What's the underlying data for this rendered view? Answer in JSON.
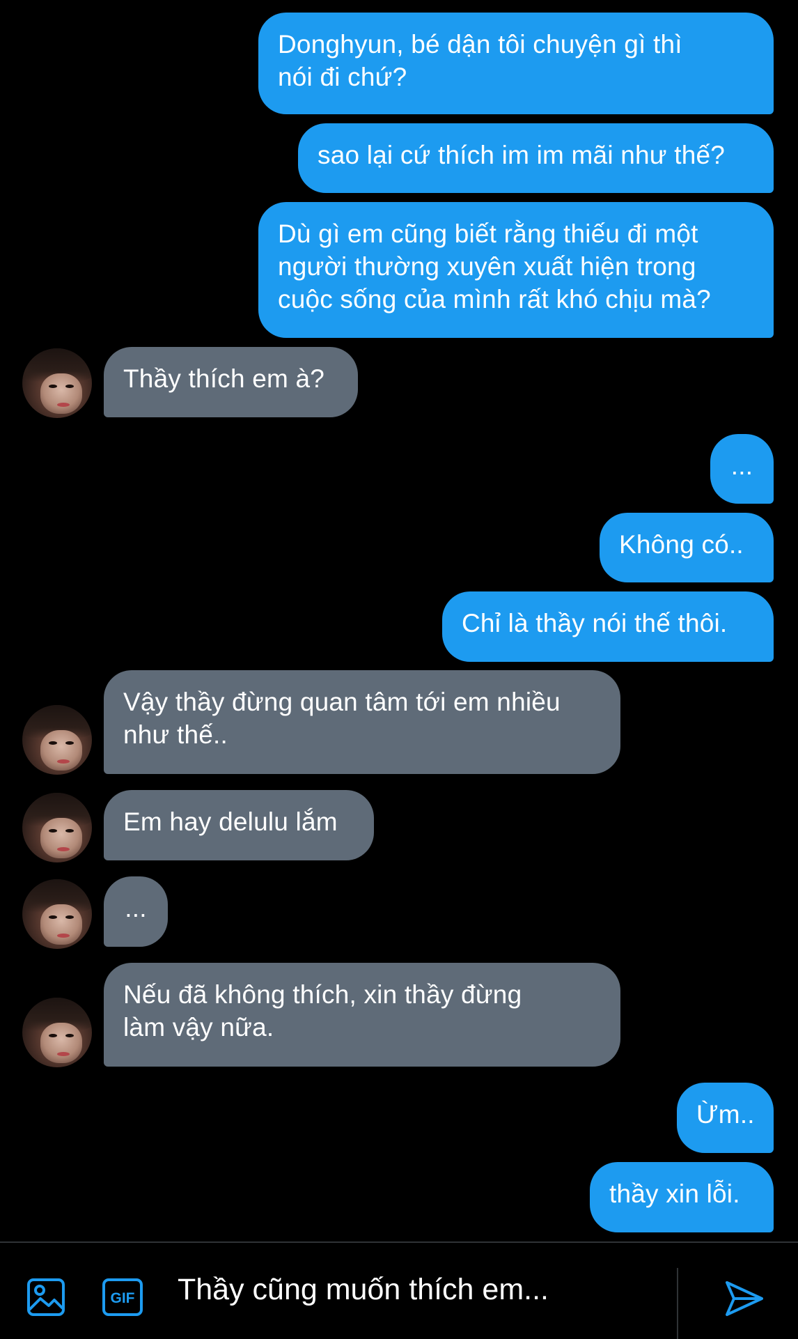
{
  "messages": [
    {
      "side": "sent",
      "text": "Donghyun, bé dận tôi chuyện gì thì\nnói đi chứ?"
    },
    {
      "side": "sent",
      "text": "sao lại cứ thích im im mãi như thế?"
    },
    {
      "side": "sent",
      "text": "Dù gì em cũng biết rằng thiếu đi một\nngười thường xuyên xuất hiện trong\ncuộc sống của mình rất khó chịu mà?"
    },
    {
      "side": "received",
      "text": "Thầy thích em à?"
    },
    {
      "side": "sent",
      "text": "..."
    },
    {
      "side": "sent",
      "text": "Không có.."
    },
    {
      "side": "sent",
      "text": "Chỉ là thầy nói thế thôi."
    },
    {
      "side": "received",
      "text": "Vậy thầy đừng quan tâm tới em nhiều\nnhư thế.."
    },
    {
      "side": "received",
      "text": "Em hay delulu lắm"
    },
    {
      "side": "received",
      "text": "..."
    },
    {
      "side": "received",
      "text": "Nếu đã không thích, xin thầy đừng\nlàm vậy nữa."
    },
    {
      "side": "sent",
      "text": "Ừm.."
    },
    {
      "side": "sent",
      "text": "thầy xin lỗi."
    }
  ],
  "composer": {
    "draft_text": "Thầy cũng muốn thích em...",
    "icons": [
      "image-icon",
      "gif-icon",
      "send-icon"
    ],
    "gif_label": "GIF"
  },
  "colors": {
    "background": "#000000",
    "sent_bubble": "#1d9bf0",
    "received_bubble": "#5f6b78",
    "accent": "#1d9bf0",
    "text": "#ffffff",
    "divider": "#2f3336"
  }
}
